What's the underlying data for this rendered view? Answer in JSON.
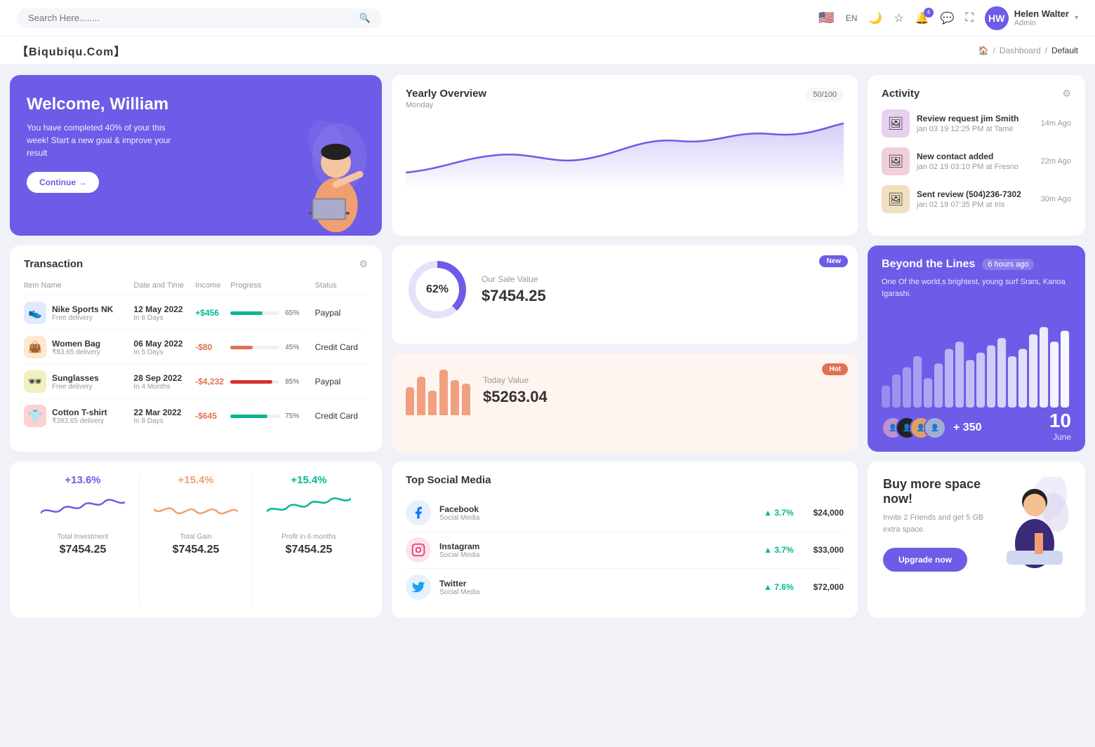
{
  "topnav": {
    "search_placeholder": "Search Here........",
    "lang": "EN",
    "notification_count": "4",
    "user": {
      "name": "Helen Walter",
      "role": "Admin",
      "initials": "HW"
    }
  },
  "breadcrumb": {
    "brand": "【Biqubiqu.Com】",
    "home_label": "🏠",
    "separator": "/",
    "dashboard": "Dashboard",
    "current": "Default"
  },
  "welcome": {
    "greeting": "Welcome, William",
    "message": "You have completed 40% of your this week! Start a new goal & improve your result",
    "button": "Continue →"
  },
  "yearly": {
    "title": "Yearly Overview",
    "sub": "Monday",
    "badge": "50/100"
  },
  "activity": {
    "title": "Activity",
    "items": [
      {
        "title": "Review request jim Smith",
        "sub": "jan 03 19 12:25 PM at Tame",
        "time": "14m Ago"
      },
      {
        "title": "New contact added",
        "sub": "jan 02 19 03:10 PM at Fresno",
        "time": "22m Ago"
      },
      {
        "title": "Sent review (504)236-7302",
        "sub": "jan 02 19 07:35 PM at Iris",
        "time": "30m Ago"
      }
    ]
  },
  "transaction": {
    "title": "Transaction",
    "columns": [
      "Item Name",
      "Date and Time",
      "Income",
      "Progress",
      "Status"
    ],
    "rows": [
      {
        "name": "Nike Sports NK",
        "sub": "Free delivery",
        "date": "12 May 2022",
        "days": "In 6 Days",
        "income": "+$456",
        "income_type": "pos",
        "progress": 65,
        "status": "Paypal",
        "color": "#00b894"
      },
      {
        "name": "Women Bag",
        "sub": "₹83.65 delivery",
        "date": "06 May 2022",
        "days": "In 5 Days",
        "income": "-$80",
        "income_type": "neg",
        "progress": 45,
        "status": "Credit Card",
        "color": "#e17055"
      },
      {
        "name": "Sunglasses",
        "sub": "Free delivery",
        "date": "28 Sep 2022",
        "days": "In 4 Months",
        "income": "-$4,232",
        "income_type": "neg",
        "progress": 85,
        "status": "Paypal",
        "color": "#d63031"
      },
      {
        "name": "Cotton T-shirt",
        "sub": "₹283.65 delivery",
        "date": "22 Mar 2022",
        "days": "In 8 Days",
        "income": "-$645",
        "income_type": "neg",
        "progress": 75,
        "status": "Credit Card",
        "color": "#00b894"
      }
    ]
  },
  "sale_value": {
    "badge": "New",
    "donut_pct": "62%",
    "title": "Our Sale Value",
    "value": "$7454.25"
  },
  "today_value": {
    "badge": "Hot",
    "title": "Today Value",
    "value": "$5263.04",
    "bars": [
      40,
      55,
      35,
      65,
      50,
      45
    ]
  },
  "beyond": {
    "title": "Beyond the Lines",
    "time": "6 hours ago",
    "desc": "One Of the world,s brightest, young surf Srars, Kanoa Igarashi.",
    "count": "+ 350",
    "day": "10",
    "month": "June",
    "bars": [
      30,
      45,
      55,
      70,
      40,
      60,
      80,
      90,
      65,
      75,
      85,
      95,
      70,
      80,
      100,
      110,
      90,
      105
    ]
  },
  "mini_stats": [
    {
      "pct": "+13.6%",
      "color": "#6c5ce7",
      "label": "Total Investment",
      "value": "$7454.25"
    },
    {
      "pct": "+15.4%",
      "color": "#f0a070",
      "label": "Total Gain",
      "value": "$7454.25"
    },
    {
      "pct": "+15.4%",
      "color": "#00b894",
      "label": "Profit in 6 months",
      "value": "$7454.25"
    }
  ],
  "social": {
    "title": "Top Social Media",
    "items": [
      {
        "name": "Facebook",
        "type": "Social Media",
        "pct": "3.7%",
        "value": "$24,000",
        "icon": "f",
        "color": "#1877f2"
      },
      {
        "name": "Instagram",
        "type": "Social Media",
        "pct": "3.7%",
        "value": "$33,000",
        "icon": "ig",
        "color": "#e1306c"
      },
      {
        "name": "Twitter",
        "type": "Social Media",
        "pct": "7.6%",
        "value": "$72,000",
        "icon": "tw",
        "color": "#1da1f2"
      }
    ]
  },
  "buyspace": {
    "title": "Buy more space now!",
    "desc": "Invite 2 Friends and get 5 GB extra space.",
    "button": "Upgrade now"
  }
}
